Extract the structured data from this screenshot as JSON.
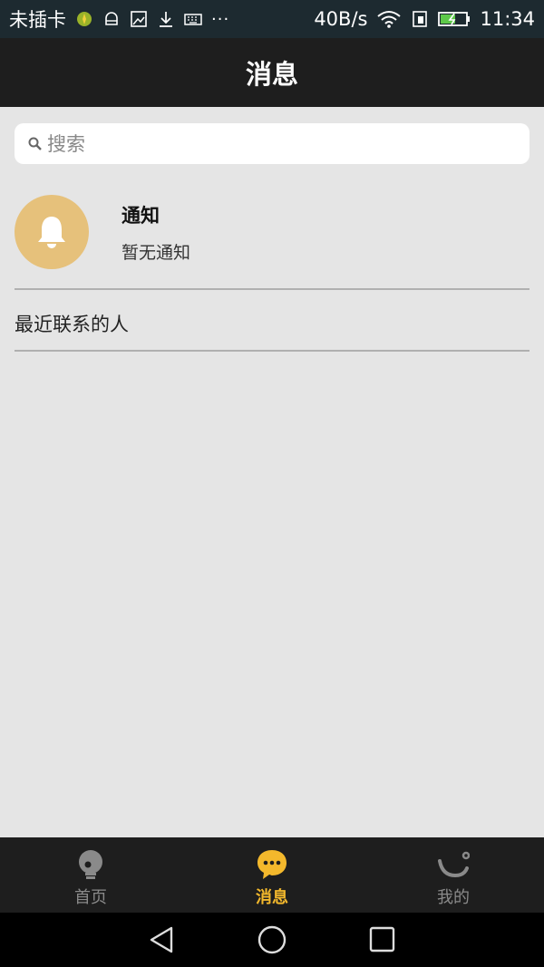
{
  "status_bar": {
    "carrier": "未插卡",
    "speed": "40B/s",
    "time": "11:34",
    "dots": "···"
  },
  "header": {
    "title": "消息"
  },
  "search": {
    "placeholder": "搜索"
  },
  "notification": {
    "title": "通知",
    "subtitle": "暂无通知",
    "avatar_color": "#e6c17b"
  },
  "recent": {
    "label": "最近联系的人"
  },
  "tabbar": {
    "tabs": [
      {
        "label": "首页",
        "icon": "bulb-icon",
        "active": false
      },
      {
        "label": "消息",
        "icon": "chat-bubble-icon",
        "active": true
      },
      {
        "label": "我的",
        "icon": "smile-icon",
        "active": false
      }
    ],
    "active_color": "#f3b82c",
    "inactive_color": "#8a8a8a"
  },
  "nav": {
    "back": "back-icon",
    "home": "home-icon",
    "recents": "recents-icon"
  }
}
